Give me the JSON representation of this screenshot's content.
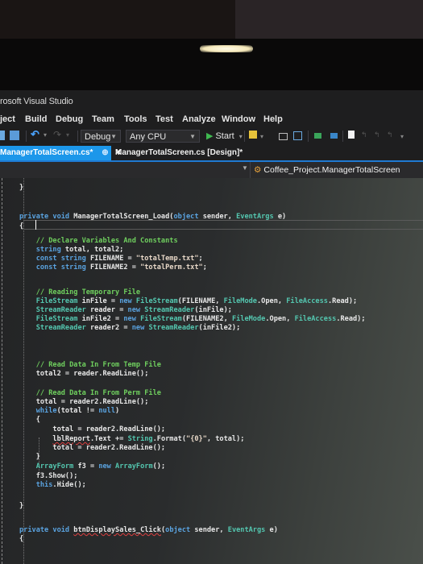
{
  "window": {
    "title": "rosoft Visual Studio"
  },
  "menu": {
    "items": [
      "ject",
      "Build",
      "Debug",
      "Team",
      "Tools",
      "Test",
      "Analyze",
      "Window",
      "Help"
    ]
  },
  "toolbar": {
    "config": "Debug",
    "platform": "Any CPU",
    "start_label": "Start",
    "icons": [
      "save-all-icon",
      "undo-icon",
      "redo-icon",
      "find-in-files-icon",
      "step-icon",
      "format-icon",
      "comment-icon",
      "uncomment-icon",
      "bookmark-icon",
      "prev-bookmark-icon",
      "next-bookmark-icon",
      "clear-bookmark-icon"
    ]
  },
  "tabs": [
    {
      "label": "ManagerTotalScreen.cs*",
      "active": true,
      "pin": "⊕",
      "close": "✕"
    },
    {
      "label": "ManagerTotalScreen.cs [Design]*",
      "active": false
    }
  ],
  "navbar": {
    "class_path": "Coffee_Project.ManagerTotalScreen"
  },
  "code": {
    "lines": [
      "}",
      "",
      "private void ManagerTotalScreen_Load(object sender, EventArgs e)",
      "{",
      "",
      "    // Declare Variables And Constants",
      "    string total, total2;",
      "    const string FILENAME = \"totalTemp.txt\";",
      "    const string FILENAME2 = \"totalPerm.txt\";",
      "",
      "    // Reading Temporary File",
      "    FileStream inFile = new FileStream(FILENAME, FileMode.Open, FileAccess.Read);",
      "    StreamReader reader = new StreamReader(inFile);",
      "    FileStream inFile2 = new FileStream(FILENAME2, FileMode.Open, FileAccess.Read);",
      "    StreamReader reader2 = new StreamReader(inFile2);",
      "",
      "",
      "    // Read Data In From Temp File",
      "    total2 = reader.ReadLine();",
      "",
      "    // Read Data In From Perm File",
      "    total = reader2.ReadLine();",
      "    while(total != null)",
      "    {",
      "        total = reader2.ReadLine();",
      "        lblReport.Text += String.Format(\"{0}\", total);",
      "        total = reader2.ReadLine();",
      "    }",
      "    ArrayForm f3 = new ArrayForm();",
      "    f3.Show();",
      "    this.Hide();",
      "",
      "}",
      "",
      "private void btnDisplaySales_Click(object sender, EventArgs e)",
      "{"
    ]
  },
  "colors": {
    "accent": "#1c97ea",
    "keyword": "#5aa3e0",
    "type": "#54c7b0",
    "comment": "#6fcf5e"
  }
}
